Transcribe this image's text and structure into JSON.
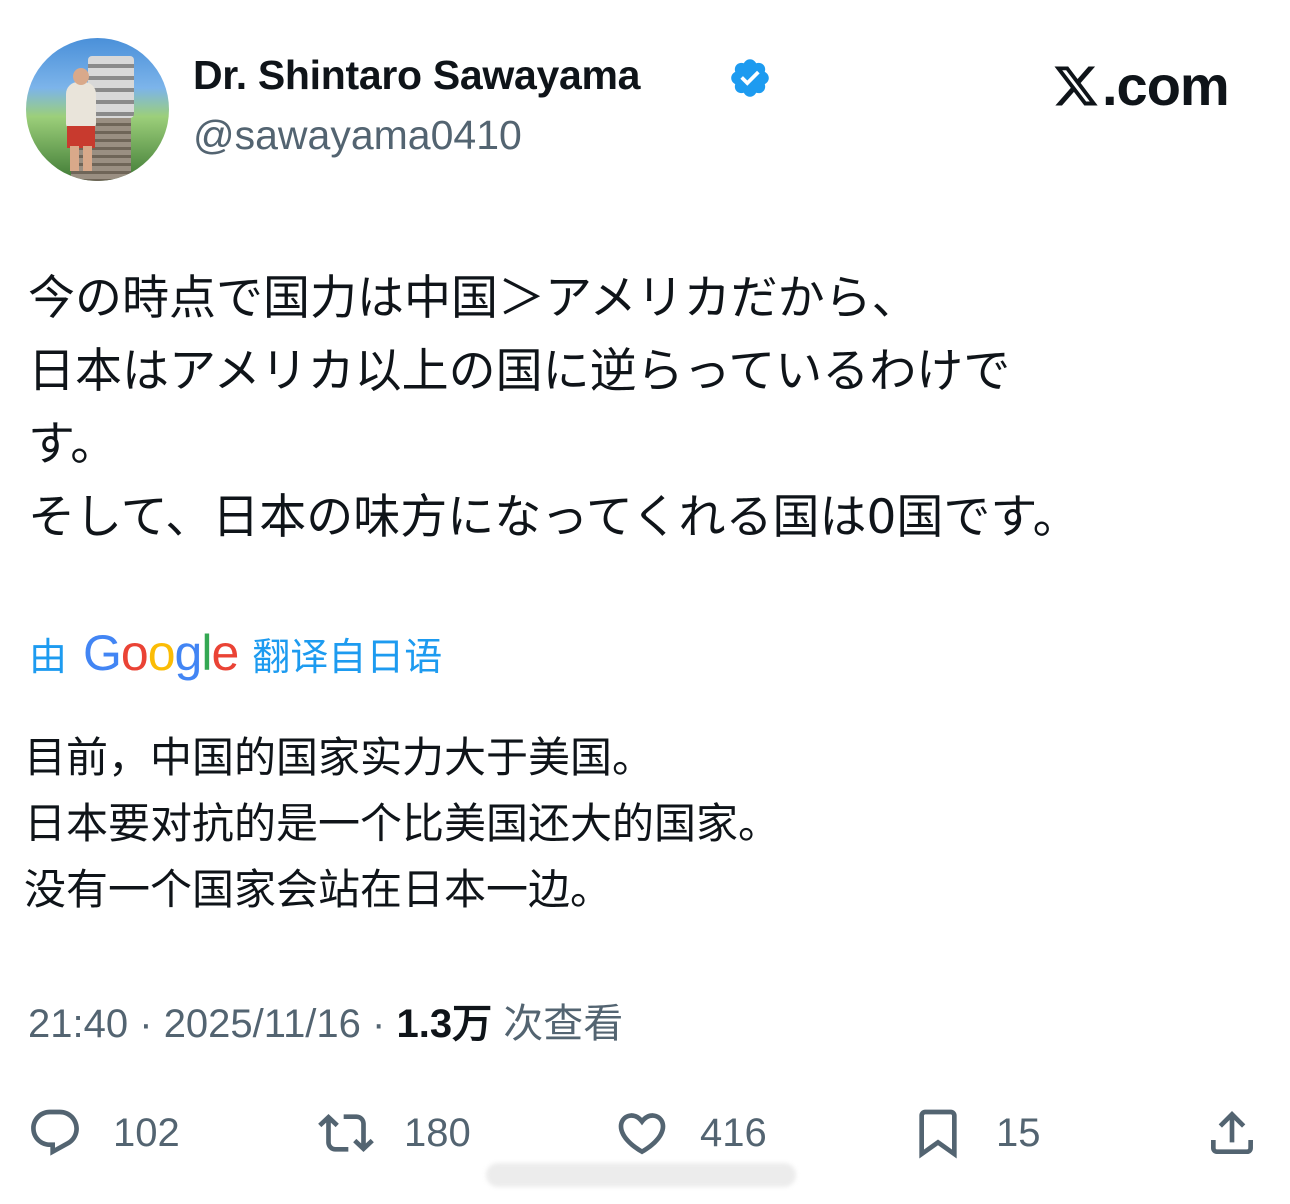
{
  "author": {
    "name": "Dr. Shintaro Sawayama",
    "handle": "@sawayama0410",
    "verified": true
  },
  "brand": {
    "label": ".com",
    "icon": "x-logo-icon"
  },
  "post": {
    "lines": [
      "今の時点で国力は中国＞アメリカだから、",
      "日本はアメリカ以上の国に逆らっているわけで",
      "す。",
      "そして、日本の味方になってくれる国は0国です。"
    ]
  },
  "translation": {
    "prefix": "由",
    "provider": "Google",
    "suffix": "翻译自日语",
    "lines": [
      "目前，中国的国家实力大于美国。",
      "日本要对抗的是一个比美国还大的国家。",
      "没有一个国家会站在日本一边。"
    ]
  },
  "meta": {
    "time": "21:40",
    "sep": "·",
    "date": "2025/11/16",
    "views": "1.3万",
    "views_label": "次查看"
  },
  "actions": {
    "replies": "102",
    "reposts": "180",
    "likes": "416",
    "bookmarks": "15"
  },
  "colors": {
    "accent": "#1d9bf0",
    "text": "#0f1419",
    "secondary": "#536471"
  }
}
